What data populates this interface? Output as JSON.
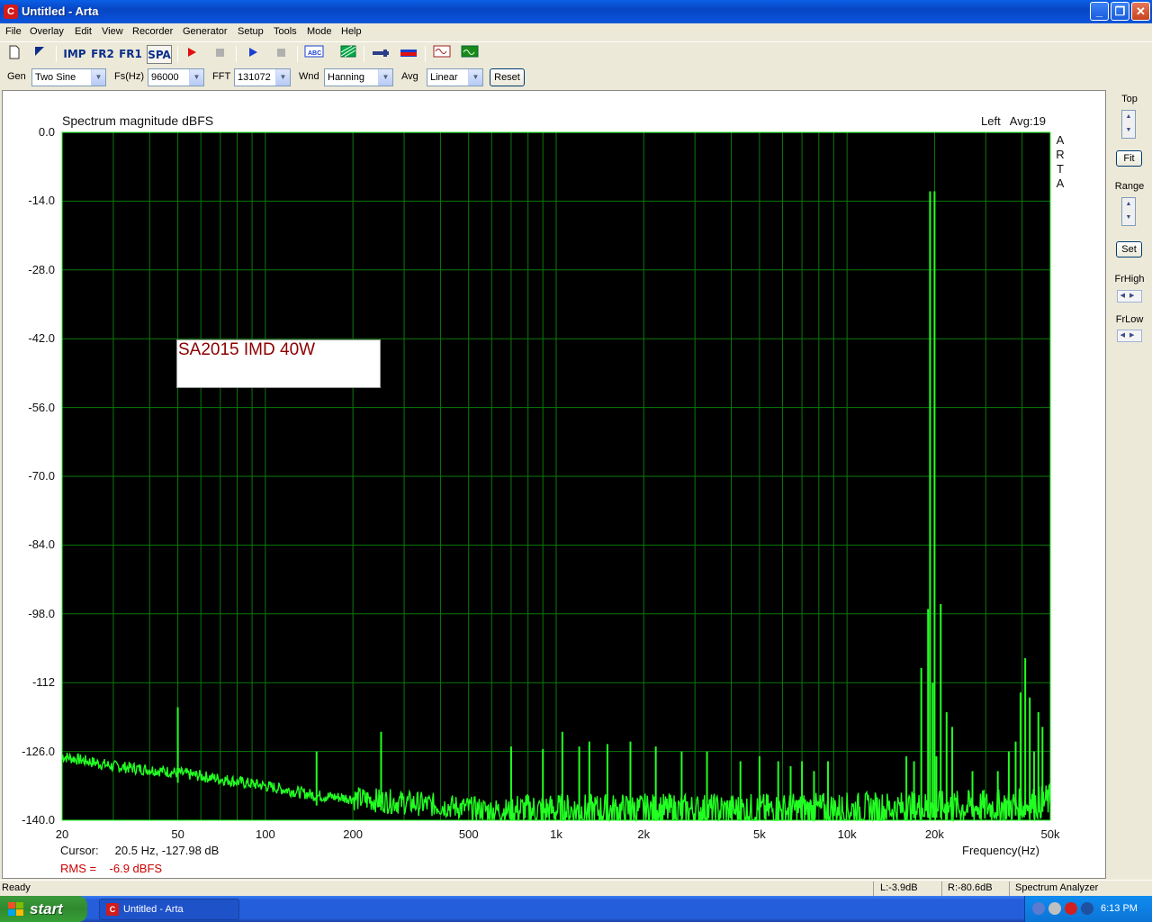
{
  "window": {
    "title": "Untitled - Arta",
    "app_icon": "C"
  },
  "menu": [
    "File",
    "Overlay",
    "Edit",
    "View",
    "Recorder",
    "Generator",
    "Setup",
    "Tools",
    "Mode",
    "Help"
  ],
  "toolbar": {
    "imp": "IMP",
    "fr2": "FR2",
    "fr1": "FR1",
    "spa": "SPA"
  },
  "controls": {
    "gen_label": "Gen",
    "gen_value": "Two Sine",
    "fs_label": "Fs(Hz)",
    "fs_value": "96000",
    "fft_label": "FFT",
    "fft_value": "131072",
    "wnd_label": "Wnd",
    "wnd_value": "Hanning",
    "avg_label": "Avg",
    "avg_value": "Linear",
    "reset_label": "Reset"
  },
  "plot": {
    "header_left": "Spectrum magnitude dBFS",
    "header_right": "Left   Avg:19",
    "side_text": "A R T A",
    "annotation": "SA2015 IMD 40W",
    "cursor": "Cursor:     20.5 Hz, -127.98 dB",
    "rms": "RMS =    -6.9 dBFS",
    "xlabel": "Frequency(Hz)"
  },
  "side_panel": {
    "top_label": "Top",
    "fit_label": "Fit",
    "range_label": "Range",
    "set_label": "Set",
    "frhigh_label": "FrHigh",
    "frlow_label": "FrLow"
  },
  "status": {
    "left": "Ready",
    "l_level": "L:-3.9dB",
    "r_level": "R:-80.6dB",
    "mode": "Spectrum Analyzer"
  },
  "taskbar": {
    "start": "start",
    "item": "Untitled - Arta",
    "clock": "6:13 PM"
  },
  "colors": {
    "trace": "#22ff22",
    "grid": "#0a7a0a",
    "plot_bg": "#000000",
    "annotation": "#8b0000",
    "rms": "#cc0000"
  },
  "chart_data": {
    "type": "line",
    "title": "Spectrum magnitude dBFS",
    "xlabel": "Frequency(Hz)",
    "ylabel": "",
    "x_scale": "log",
    "xlim": [
      20,
      50000
    ],
    "ylim": [
      -140,
      0
    ],
    "y_ticks": [
      "0.0",
      "-14.0",
      "-28.0",
      "-42.0",
      "-56.0",
      "-70.0",
      "-84.0",
      "-98.0",
      "-112",
      "-126.0",
      "-140.0"
    ],
    "x_tick_labels": [
      {
        "f": 20,
        "t": "20"
      },
      {
        "f": 50,
        "t": "50"
      },
      {
        "f": 100,
        "t": "100"
      },
      {
        "f": 200,
        "t": "200"
      },
      {
        "f": 500,
        "t": "500"
      },
      {
        "f": 1000,
        "t": "1k"
      },
      {
        "f": 2000,
        "t": "2k"
      },
      {
        "f": 5000,
        "t": "5k"
      },
      {
        "f": 10000,
        "t": "10k"
      },
      {
        "f": 20000,
        "t": "20k"
      },
      {
        "f": 50000,
        "t": "50k"
      }
    ],
    "noise_floor": [
      [
        20,
        -127
      ],
      [
        30,
        -129
      ],
      [
        45,
        -130
      ],
      [
        60,
        -131
      ],
      [
        100,
        -133
      ],
      [
        150,
        -135
      ],
      [
        250,
        -136
      ],
      [
        400,
        -137
      ],
      [
        600,
        -138
      ],
      [
        1000,
        -138
      ],
      [
        5000,
        -138
      ],
      [
        20000,
        -137.5
      ],
      [
        40000,
        -137
      ],
      [
        50000,
        -136
      ]
    ],
    "peaks": [
      [
        50,
        -117
      ],
      [
        150,
        -126
      ],
      [
        250,
        -122
      ],
      [
        700,
        -125
      ],
      [
        900,
        -125.5
      ],
      [
        1050,
        -122
      ],
      [
        1200,
        -125
      ],
      [
        1300,
        -124
      ],
      [
        1500,
        -124.5
      ],
      [
        1800,
        -124
      ],
      [
        2200,
        -125
      ],
      [
        2700,
        -126
      ],
      [
        3300,
        -126
      ],
      [
        4300,
        -128
      ],
      [
        5000,
        -127
      ],
      [
        5800,
        -128
      ],
      [
        6400,
        -129
      ],
      [
        7000,
        -128
      ],
      [
        7700,
        -130
      ],
      [
        8600,
        -128
      ],
      [
        16000,
        -127
      ],
      [
        17000,
        -128
      ],
      [
        18000,
        -109
      ],
      [
        19000,
        -97
      ],
      [
        19300,
        -12
      ],
      [
        19700,
        -112
      ],
      [
        20000,
        -12
      ],
      [
        20300,
        -127
      ],
      [
        21000,
        -96
      ],
      [
        22000,
        -118
      ],
      [
        23000,
        -121
      ],
      [
        27000,
        -130
      ],
      [
        33000,
        -130
      ],
      [
        36000,
        -126
      ],
      [
        38000,
        -124
      ],
      [
        39500,
        -114
      ],
      [
        41000,
        -107
      ],
      [
        42500,
        -115
      ],
      [
        44000,
        -126
      ],
      [
        45500,
        -118
      ],
      [
        47000,
        -121
      ]
    ]
  }
}
